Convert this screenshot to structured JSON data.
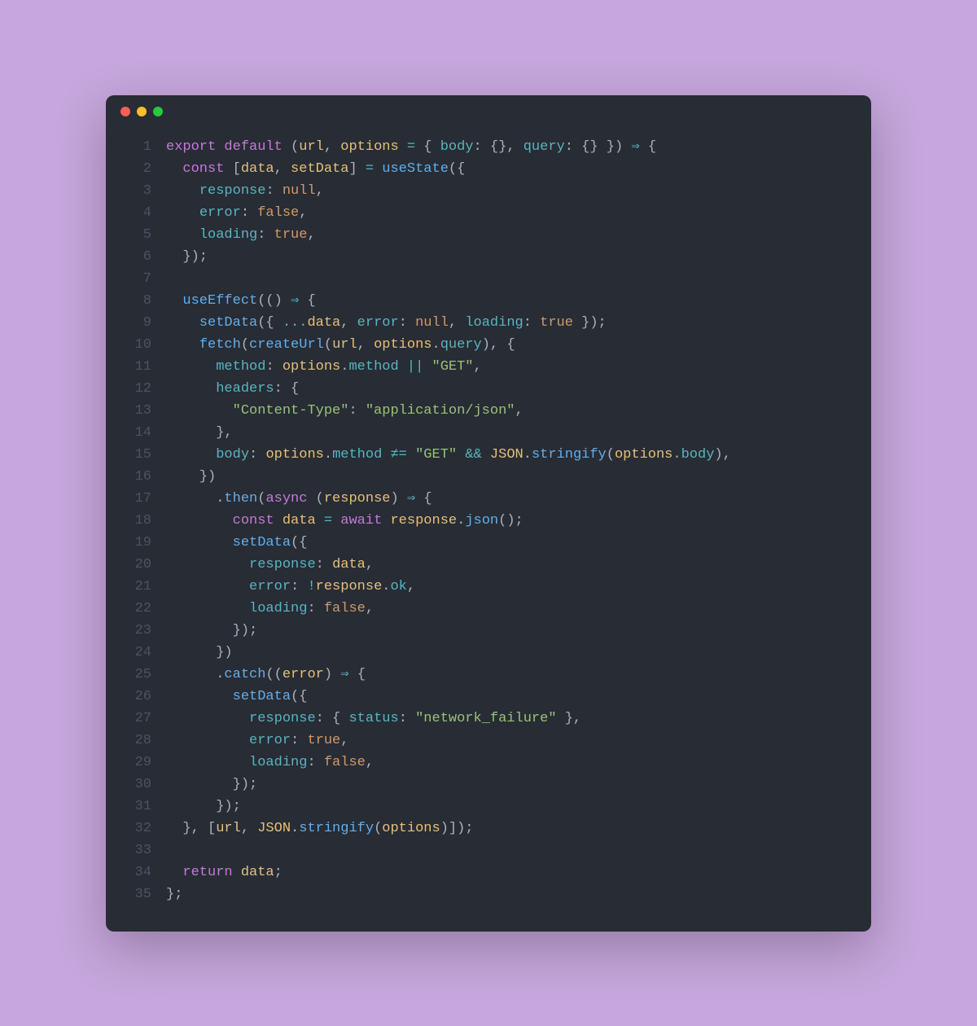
{
  "window": {
    "traffic_lights": [
      "close",
      "minimize",
      "zoom"
    ]
  },
  "code": {
    "language": "javascript",
    "line_count": 35,
    "lines": [
      {
        "n": 1,
        "tokens": [
          [
            "kw",
            "export"
          ],
          [
            "p",
            " "
          ],
          [
            "kw",
            "default"
          ],
          [
            "p",
            " "
          ],
          [
            "p",
            "("
          ],
          [
            "id",
            "url"
          ],
          [
            "p",
            ", "
          ],
          [
            "id",
            "options"
          ],
          [
            "p",
            " "
          ],
          [
            "op",
            "="
          ],
          [
            "p",
            " "
          ],
          [
            "p",
            "{ "
          ],
          [
            "prop",
            "body"
          ],
          [
            "p",
            ": "
          ],
          [
            "p",
            "{}"
          ],
          [
            "p",
            ", "
          ],
          [
            "prop",
            "query"
          ],
          [
            "p",
            ": "
          ],
          [
            "p",
            "{}"
          ],
          [
            "p",
            " }"
          ],
          [
            "p",
            ")"
          ],
          [
            "p",
            " "
          ],
          [
            "op",
            "⇒"
          ],
          [
            "p",
            " "
          ],
          [
            "p",
            "{"
          ]
        ]
      },
      {
        "n": 2,
        "tokens": [
          [
            "p",
            "  "
          ],
          [
            "kw",
            "const"
          ],
          [
            "p",
            " ["
          ],
          [
            "id",
            "data"
          ],
          [
            "p",
            ", "
          ],
          [
            "id",
            "setData"
          ],
          [
            "p",
            "] "
          ],
          [
            "op",
            "="
          ],
          [
            "p",
            " "
          ],
          [
            "fn",
            "useState"
          ],
          [
            "p",
            "("
          ],
          [
            "p",
            "{"
          ]
        ]
      },
      {
        "n": 3,
        "tokens": [
          [
            "p",
            "    "
          ],
          [
            "prop",
            "response"
          ],
          [
            "p",
            ": "
          ],
          [
            "null",
            "null"
          ],
          [
            "p",
            ","
          ]
        ]
      },
      {
        "n": 4,
        "tokens": [
          [
            "p",
            "    "
          ],
          [
            "prop",
            "error"
          ],
          [
            "p",
            ": "
          ],
          [
            "bool",
            "false"
          ],
          [
            "p",
            ","
          ]
        ]
      },
      {
        "n": 5,
        "tokens": [
          [
            "p",
            "    "
          ],
          [
            "prop",
            "loading"
          ],
          [
            "p",
            ": "
          ],
          [
            "bool",
            "true"
          ],
          [
            "p",
            ","
          ]
        ]
      },
      {
        "n": 6,
        "tokens": [
          [
            "p",
            "  });"
          ]
        ]
      },
      {
        "n": 7,
        "tokens": [
          [
            "p",
            ""
          ]
        ]
      },
      {
        "n": 8,
        "tokens": [
          [
            "p",
            "  "
          ],
          [
            "fn",
            "useEffect"
          ],
          [
            "p",
            "(() "
          ],
          [
            "op",
            "⇒"
          ],
          [
            "p",
            " {"
          ]
        ]
      },
      {
        "n": 9,
        "tokens": [
          [
            "p",
            "    "
          ],
          [
            "fn",
            "setData"
          ],
          [
            "p",
            "({ "
          ],
          [
            "op",
            "..."
          ],
          [
            "id",
            "data"
          ],
          [
            "p",
            ", "
          ],
          [
            "prop",
            "error"
          ],
          [
            "p",
            ": "
          ],
          [
            "null",
            "null"
          ],
          [
            "p",
            ", "
          ],
          [
            "prop",
            "loading"
          ],
          [
            "p",
            ": "
          ],
          [
            "bool",
            "true"
          ],
          [
            "p",
            " });"
          ]
        ]
      },
      {
        "n": 10,
        "tokens": [
          [
            "p",
            "    "
          ],
          [
            "fn",
            "fetch"
          ],
          [
            "p",
            "("
          ],
          [
            "fn",
            "createUrl"
          ],
          [
            "p",
            "("
          ],
          [
            "id",
            "url"
          ],
          [
            "p",
            ", "
          ],
          [
            "id",
            "options"
          ],
          [
            "p",
            "."
          ],
          [
            "prop",
            "query"
          ],
          [
            "p",
            "), {"
          ]
        ]
      },
      {
        "n": 11,
        "tokens": [
          [
            "p",
            "      "
          ],
          [
            "prop",
            "method"
          ],
          [
            "p",
            ": "
          ],
          [
            "id",
            "options"
          ],
          [
            "p",
            "."
          ],
          [
            "prop",
            "method"
          ],
          [
            "p",
            " "
          ],
          [
            "op",
            "||"
          ],
          [
            "p",
            " "
          ],
          [
            "str",
            "\"GET\""
          ],
          [
            "p",
            ","
          ]
        ]
      },
      {
        "n": 12,
        "tokens": [
          [
            "p",
            "      "
          ],
          [
            "prop",
            "headers"
          ],
          [
            "p",
            ": {"
          ]
        ]
      },
      {
        "n": 13,
        "tokens": [
          [
            "p",
            "        "
          ],
          [
            "str",
            "\"Content-Type\""
          ],
          [
            "p",
            ": "
          ],
          [
            "str",
            "\"application/json\""
          ],
          [
            "p",
            ","
          ]
        ]
      },
      {
        "n": 14,
        "tokens": [
          [
            "p",
            "      },"
          ]
        ]
      },
      {
        "n": 15,
        "tokens": [
          [
            "p",
            "      "
          ],
          [
            "prop",
            "body"
          ],
          [
            "p",
            ": "
          ],
          [
            "id",
            "options"
          ],
          [
            "p",
            "."
          ],
          [
            "prop",
            "method"
          ],
          [
            "p",
            " "
          ],
          [
            "op",
            "≠="
          ],
          [
            "p",
            " "
          ],
          [
            "str",
            "\"GET\""
          ],
          [
            "p",
            " "
          ],
          [
            "op",
            "&&"
          ],
          [
            "p",
            " "
          ],
          [
            "id",
            "JSON"
          ],
          [
            "p",
            "."
          ],
          [
            "fn",
            "stringify"
          ],
          [
            "p",
            "("
          ],
          [
            "id",
            "options"
          ],
          [
            "p",
            "."
          ],
          [
            "prop",
            "body"
          ],
          [
            "p",
            "),"
          ]
        ]
      },
      {
        "n": 16,
        "tokens": [
          [
            "p",
            "    })"
          ]
        ]
      },
      {
        "n": 17,
        "tokens": [
          [
            "p",
            "      ."
          ],
          [
            "fn",
            "then"
          ],
          [
            "p",
            "("
          ],
          [
            "kw",
            "async"
          ],
          [
            "p",
            " ("
          ],
          [
            "id",
            "response"
          ],
          [
            "p",
            ") "
          ],
          [
            "op",
            "⇒"
          ],
          [
            "p",
            " {"
          ]
        ]
      },
      {
        "n": 18,
        "tokens": [
          [
            "p",
            "        "
          ],
          [
            "kw",
            "const"
          ],
          [
            "p",
            " "
          ],
          [
            "id",
            "data"
          ],
          [
            "p",
            " "
          ],
          [
            "op",
            "="
          ],
          [
            "p",
            " "
          ],
          [
            "kw",
            "await"
          ],
          [
            "p",
            " "
          ],
          [
            "id",
            "response"
          ],
          [
            "p",
            "."
          ],
          [
            "fn",
            "json"
          ],
          [
            "p",
            "();"
          ]
        ]
      },
      {
        "n": 19,
        "tokens": [
          [
            "p",
            "        "
          ],
          [
            "fn",
            "setData"
          ],
          [
            "p",
            "({"
          ]
        ]
      },
      {
        "n": 20,
        "tokens": [
          [
            "p",
            "          "
          ],
          [
            "prop",
            "response"
          ],
          [
            "p",
            ": "
          ],
          [
            "id",
            "data"
          ],
          [
            "p",
            ","
          ]
        ]
      },
      {
        "n": 21,
        "tokens": [
          [
            "p",
            "          "
          ],
          [
            "prop",
            "error"
          ],
          [
            "p",
            ": "
          ],
          [
            "op",
            "!"
          ],
          [
            "id",
            "response"
          ],
          [
            "p",
            "."
          ],
          [
            "prop",
            "ok"
          ],
          [
            "p",
            ","
          ]
        ]
      },
      {
        "n": 22,
        "tokens": [
          [
            "p",
            "          "
          ],
          [
            "prop",
            "loading"
          ],
          [
            "p",
            ": "
          ],
          [
            "bool",
            "false"
          ],
          [
            "p",
            ","
          ]
        ]
      },
      {
        "n": 23,
        "tokens": [
          [
            "p",
            "        });"
          ]
        ]
      },
      {
        "n": 24,
        "tokens": [
          [
            "p",
            "      })"
          ]
        ]
      },
      {
        "n": 25,
        "tokens": [
          [
            "p",
            "      ."
          ],
          [
            "fn",
            "catch"
          ],
          [
            "p",
            "(("
          ],
          [
            "id",
            "error"
          ],
          [
            "p",
            ") "
          ],
          [
            "op",
            "⇒"
          ],
          [
            "p",
            " {"
          ]
        ]
      },
      {
        "n": 26,
        "tokens": [
          [
            "p",
            "        "
          ],
          [
            "fn",
            "setData"
          ],
          [
            "p",
            "({"
          ]
        ]
      },
      {
        "n": 27,
        "tokens": [
          [
            "p",
            "          "
          ],
          [
            "prop",
            "response"
          ],
          [
            "p",
            ": { "
          ],
          [
            "prop",
            "status"
          ],
          [
            "p",
            ": "
          ],
          [
            "str",
            "\"network_failure\""
          ],
          [
            "p",
            " },"
          ]
        ]
      },
      {
        "n": 28,
        "tokens": [
          [
            "p",
            "          "
          ],
          [
            "prop",
            "error"
          ],
          [
            "p",
            ": "
          ],
          [
            "bool",
            "true"
          ],
          [
            "p",
            ","
          ]
        ]
      },
      {
        "n": 29,
        "tokens": [
          [
            "p",
            "          "
          ],
          [
            "prop",
            "loading"
          ],
          [
            "p",
            ": "
          ],
          [
            "bool",
            "false"
          ],
          [
            "p",
            ","
          ]
        ]
      },
      {
        "n": 30,
        "tokens": [
          [
            "p",
            "        });"
          ]
        ]
      },
      {
        "n": 31,
        "tokens": [
          [
            "p",
            "      });"
          ]
        ]
      },
      {
        "n": 32,
        "tokens": [
          [
            "p",
            "  }, ["
          ],
          [
            "id",
            "url"
          ],
          [
            "p",
            ", "
          ],
          [
            "id",
            "JSON"
          ],
          [
            "p",
            "."
          ],
          [
            "fn",
            "stringify"
          ],
          [
            "p",
            "("
          ],
          [
            "id",
            "options"
          ],
          [
            "p",
            ")]);"
          ]
        ]
      },
      {
        "n": 33,
        "tokens": [
          [
            "p",
            ""
          ]
        ]
      },
      {
        "n": 34,
        "tokens": [
          [
            "p",
            "  "
          ],
          [
            "kw",
            "return"
          ],
          [
            "p",
            " "
          ],
          [
            "id",
            "data"
          ],
          [
            "p",
            ";"
          ]
        ]
      },
      {
        "n": 35,
        "tokens": [
          [
            "p",
            "};"
          ]
        ]
      }
    ]
  }
}
